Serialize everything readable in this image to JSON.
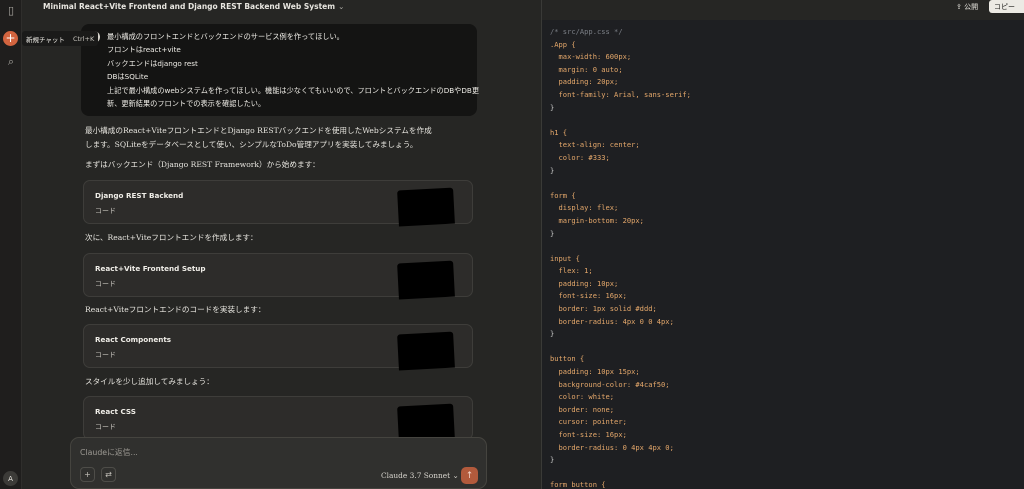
{
  "header": {
    "title": "Minimal React+Vite Frontend and Django REST Backend Web System"
  },
  "sidebar": {
    "tooltip_label": "新規チャット",
    "tooltip_shortcut": "Ctrl+K",
    "user_initial": "A"
  },
  "user_message": {
    "avatar_initial": "A",
    "lines": [
      "最小構成のフロントエンドとバックエンドのサービス例を作ってほしい。",
      "フロントはreact+vite",
      "バックエンドはdjango rest",
      "DBはSQLite",
      "上記で最小構成のwebシステムを作ってほしい。機能は少なくてもいいので、フロントとバックエンドのDBやDB更",
      "新、更新結果のフロントでの表示を確認したい。"
    ]
  },
  "response": {
    "intro_line1": "最小構成のReact+ViteフロントエンドとDjango RESTバックエンドを使用したWebシステムを作成",
    "intro_line2": "します。SQLiteをデータベースとして使い、シンプルなToDo管理アプリを実装してみましょう。",
    "step1": "まずはバックエンド（Django REST Framework）から始めます：",
    "step2": "次に、React+Viteフロントエンドを作成します：",
    "step3": "React+Viteフロントエンドのコードを実装します：",
    "step4": "スタイルを少し追加してみましょう："
  },
  "artifacts": [
    {
      "title": "Django REST Backend",
      "subtitle": "コード"
    },
    {
      "title": "React+Vite Frontend Setup",
      "subtitle": "コード"
    },
    {
      "title": "React Components",
      "subtitle": "コード"
    },
    {
      "title": "React CSS",
      "subtitle": "コード"
    }
  ],
  "composer": {
    "placeholder": "Claudeに返信...",
    "model": "Claude 3.7 Sonnet",
    "add_icon": "+",
    "tools_icon": "⇄",
    "send_icon": "↑"
  },
  "panel": {
    "publish_label": "公開",
    "copy_label": "コピー",
    "code_lines": [
      {
        "cls": "c-comment",
        "text": "/* src/App.css */"
      },
      {
        "cls": "c-sel",
        "text": ".App {"
      },
      {
        "cls": "c-prop",
        "text": "  max-width: 600px;"
      },
      {
        "cls": "c-prop",
        "text": "  margin: 0 auto;"
      },
      {
        "cls": "c-prop",
        "text": "  padding: 20px;"
      },
      {
        "cls": "c-prop",
        "text": "  font-family: Arial, sans-serif;"
      },
      {
        "cls": "c-punct",
        "text": "}"
      },
      {
        "cls": "c-punct",
        "text": ""
      },
      {
        "cls": "c-sel",
        "text": "h1 {"
      },
      {
        "cls": "c-prop",
        "text": "  text-align: center;"
      },
      {
        "cls": "c-prop",
        "text": "  color: #333;"
      },
      {
        "cls": "c-punct",
        "text": "}"
      },
      {
        "cls": "c-punct",
        "text": ""
      },
      {
        "cls": "c-sel",
        "text": "form {"
      },
      {
        "cls": "c-prop",
        "text": "  display: flex;"
      },
      {
        "cls": "c-prop",
        "text": "  margin-bottom: 20px;"
      },
      {
        "cls": "c-punct",
        "text": "}"
      },
      {
        "cls": "c-punct",
        "text": ""
      },
      {
        "cls": "c-sel",
        "text": "input {"
      },
      {
        "cls": "c-prop",
        "text": "  flex: 1;"
      },
      {
        "cls": "c-prop",
        "text": "  padding: 10px;"
      },
      {
        "cls": "c-prop",
        "text": "  font-size: 16px;"
      },
      {
        "cls": "c-prop",
        "text": "  border: 1px solid #ddd;"
      },
      {
        "cls": "c-prop",
        "text": "  border-radius: 4px 0 0 4px;"
      },
      {
        "cls": "c-punct",
        "text": "}"
      },
      {
        "cls": "c-punct",
        "text": ""
      },
      {
        "cls": "c-sel",
        "text": "button {"
      },
      {
        "cls": "c-prop",
        "text": "  padding: 10px 15px;"
      },
      {
        "cls": "c-prop",
        "text": "  background-color: #4caf50;"
      },
      {
        "cls": "c-prop",
        "text": "  color: white;"
      },
      {
        "cls": "c-prop",
        "text": "  border: none;"
      },
      {
        "cls": "c-prop",
        "text": "  cursor: pointer;"
      },
      {
        "cls": "c-prop",
        "text": "  font-size: 16px;"
      },
      {
        "cls": "c-prop",
        "text": "  border-radius: 0 4px 4px 0;"
      },
      {
        "cls": "c-punct",
        "text": "}"
      },
      {
        "cls": "c-punct",
        "text": ""
      },
      {
        "cls": "c-sel",
        "text": "form button {"
      }
    ]
  }
}
